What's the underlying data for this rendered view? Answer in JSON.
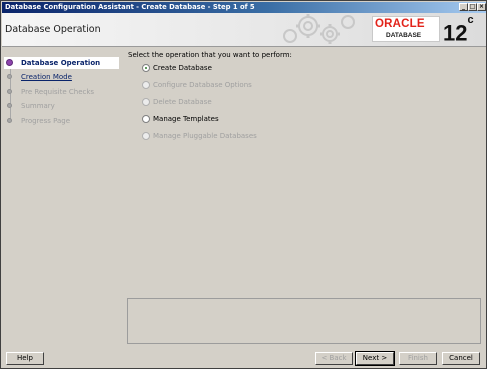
{
  "window": {
    "title": "Database Configuration Assistant - Create Database - Step 1 of 5",
    "controls": [
      "_",
      "□",
      "×"
    ]
  },
  "header": {
    "page_title": "Database Operation",
    "brand": "ORACLE",
    "brand_sub": "DATABASE",
    "version": "12",
    "version_suffix": "c",
    "brand_color": "#e2231a"
  },
  "nav": {
    "items": [
      {
        "label": "Database Operation",
        "state": "active"
      },
      {
        "label": "Creation Mode",
        "state": "link"
      },
      {
        "label": "Pre Requisite Checks",
        "state": "disabled"
      },
      {
        "label": "Summary",
        "state": "disabled"
      },
      {
        "label": "Progress Page",
        "state": "disabled"
      }
    ]
  },
  "main": {
    "prompt": "Select the operation that you want to perform:",
    "options": [
      {
        "label": "Create Database",
        "checked": true,
        "enabled": true
      },
      {
        "label": "Configure Database Options",
        "checked": false,
        "enabled": false
      },
      {
        "label": "Delete Database",
        "checked": false,
        "enabled": false
      },
      {
        "label": "Manage Templates",
        "checked": false,
        "enabled": true
      },
      {
        "label": "Manage Pluggable Databases",
        "checked": false,
        "enabled": false
      }
    ]
  },
  "buttons": {
    "help": "Help",
    "back": "< Back",
    "next": "Next >",
    "finish": "Finish",
    "cancel": "Cancel"
  }
}
